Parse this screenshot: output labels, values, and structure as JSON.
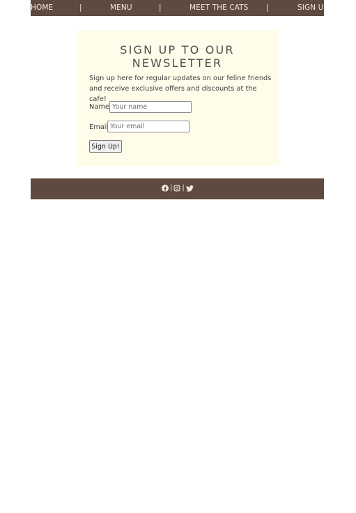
{
  "nav": {
    "items": [
      {
        "label": "HOME"
      },
      {
        "label": "MENU"
      },
      {
        "label": "MEET THE CATS"
      },
      {
        "label": "SIGN UP"
      }
    ],
    "separator": "|"
  },
  "newsletter": {
    "title": "SIGN UP TO OUR NEWSLETTER",
    "description": "Sign up here for regular updates on our feline friends and receive exclusive offers and discounts at the cafe!",
    "name_label": "Name",
    "name_placeholder": "Your name",
    "email_label": "Email",
    "email_placeholder": "Your email",
    "submit_label": "Sign Up!"
  },
  "footer": {
    "social": [
      "facebook-icon",
      "instagram-icon",
      "twitter-icon"
    ],
    "separator": "|"
  },
  "colors": {
    "nav_bg": "#5e4a3e",
    "nav_text": "#f3ece4",
    "panel_bg": "#fffdea",
    "title_text": "#4d4d4d"
  }
}
